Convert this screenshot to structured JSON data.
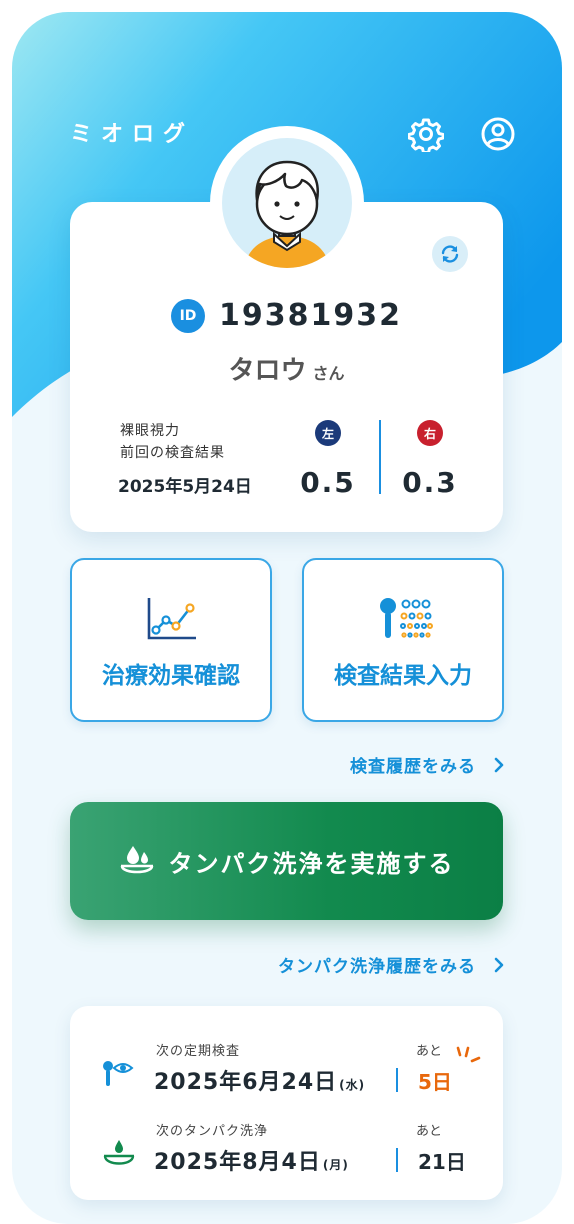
{
  "app": {
    "title": "ミオログ"
  },
  "header": {
    "settings_icon": "gear-icon",
    "account_icon": "user-circle-icon"
  },
  "profile": {
    "id_badge": "ID",
    "id_number": "19381932",
    "name": "タロウ",
    "honorific": "さん",
    "vision_label_line1": "裸眼視力",
    "vision_label_line2": "前回の検査結果",
    "vision_date": "2025年5月24日",
    "left_label": "左",
    "left_value": "0.5",
    "right_label": "右",
    "right_value": "0.3"
  },
  "tiles": [
    {
      "label": "治療効果確認",
      "icon": "line-chart-icon"
    },
    {
      "label": "検査結果入力",
      "icon": "eye-chart-icon"
    }
  ],
  "links": {
    "exam_history": "検査履歴をみる",
    "cleaning_history": "タンパク洗浄履歴をみる"
  },
  "cta": {
    "label": "タンパク洗浄を実施する",
    "icon": "lens-drop-icon"
  },
  "schedule": [
    {
      "sub": "次の定期検査",
      "date": "2025年6月24日",
      "weekday": "(水)",
      "ato": "あと",
      "days": "5日",
      "icon": "eye-exam-icon"
    },
    {
      "sub": "次のタンパク洗浄",
      "date": "2025年8月4日",
      "weekday": "(月)",
      "ato": "あと",
      "days": "21日",
      "icon": "lens-clean-icon"
    }
  ],
  "colors": {
    "primary": "#1590d8",
    "left_eye": "#1b3a7a",
    "right_eye": "#c8202e",
    "cta": "#128a4e",
    "urgent": "#e8680c"
  }
}
